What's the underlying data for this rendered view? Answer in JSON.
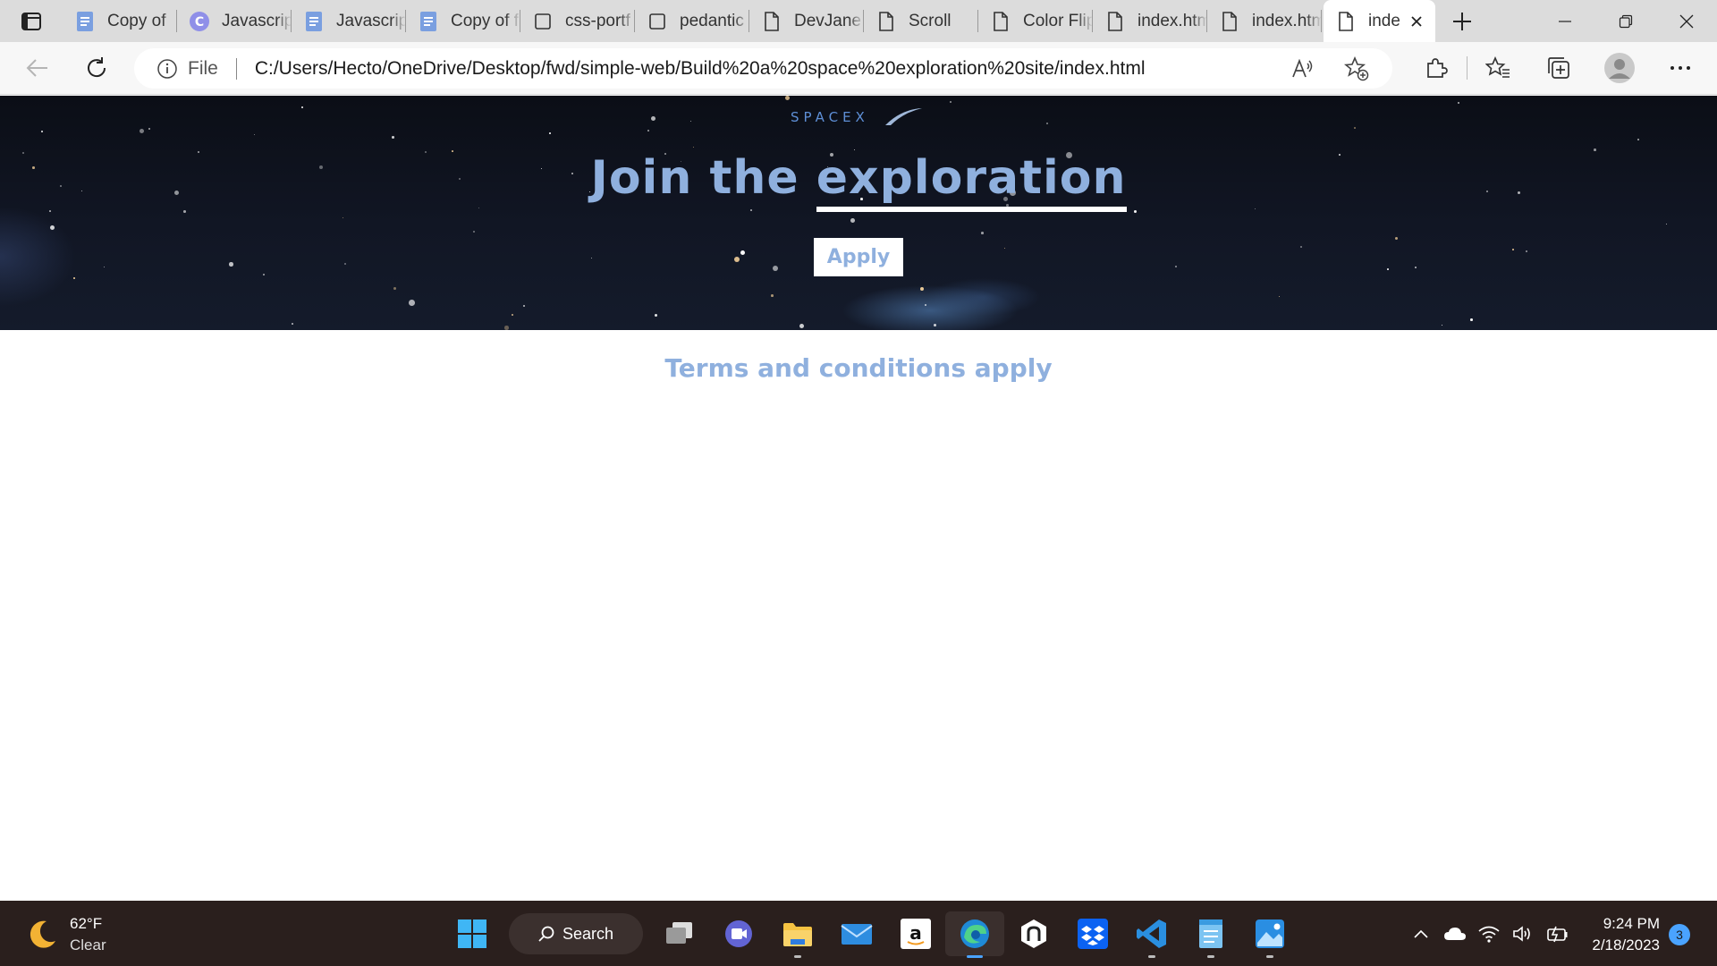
{
  "browser": {
    "tabs": [
      {
        "label": "Copy of",
        "icon": "docs-icon"
      },
      {
        "label": "Javascrip",
        "icon": "c-logo-icon"
      },
      {
        "label": "Javascrip",
        "icon": "docs-icon"
      },
      {
        "label": "Copy of f",
        "icon": "docs-icon"
      },
      {
        "label": "css-portf",
        "icon": "square-icon"
      },
      {
        "label": "pedantic",
        "icon": "square-icon"
      },
      {
        "label": "DevJane",
        "icon": "page-icon"
      },
      {
        "label": "Scroll",
        "icon": "page-icon"
      },
      {
        "label": "Color Flip",
        "icon": "page-icon"
      },
      {
        "label": "index.htm",
        "icon": "page-icon"
      },
      {
        "label": "index.htm",
        "icon": "page-icon"
      }
    ],
    "active_tab": {
      "label": "inde",
      "icon": "page-icon"
    },
    "address": {
      "scheme_label": "File",
      "url": "C:/Users/Hecto/OneDrive/Desktop/fwd/simple-web/Build%20a%20space%20exploration%20site/index.html"
    }
  },
  "page": {
    "logo_text": "SPACEX",
    "title_prefix": "Join the ",
    "title_highlight": "exploration",
    "apply_label": "Apply",
    "terms_text": "Terms and conditions apply"
  },
  "taskbar": {
    "weather_temp": "62°F",
    "weather_desc": "Clear",
    "search_label": "Search",
    "time": "9:24 PM",
    "date": "2/18/2023",
    "notification_count": "3"
  },
  "colors": {
    "accent_text": "#8fb0de",
    "hero_bg": "#0b0e16",
    "taskbar_bg": "#2a1f1d",
    "edge_blue": "#4aa3ff"
  }
}
